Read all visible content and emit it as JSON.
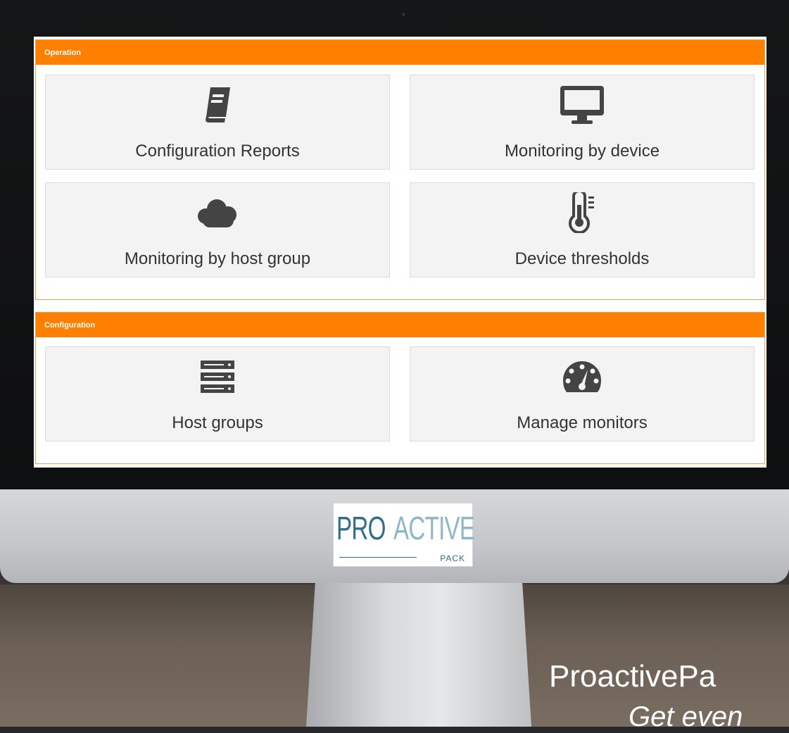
{
  "operation": {
    "header": "Operation",
    "tiles": [
      {
        "label": "Configuration Reports",
        "icon": "book-icon"
      },
      {
        "label": "Monitoring by device",
        "icon": "desktop-icon"
      },
      {
        "label": "Monitoring by host group",
        "icon": "cloud-icon"
      },
      {
        "label": "Device thresholds",
        "icon": "thermometer-icon"
      }
    ]
  },
  "configuration": {
    "header": "Configuration",
    "tiles": [
      {
        "label": "Host groups",
        "icon": "server-icon"
      },
      {
        "label": "Manage monitors",
        "icon": "dashboard-icon"
      }
    ]
  },
  "logo": {
    "text_primary": "PRO",
    "text_secondary": "ACTIVE",
    "text_sub": "PACK"
  },
  "tagline": {
    "title": "ProactivePa",
    "subtitle": "Get even"
  },
  "colors": {
    "accent": "#ff8000",
    "tile_bg": "#f3f3f3",
    "icon": "#444444"
  }
}
